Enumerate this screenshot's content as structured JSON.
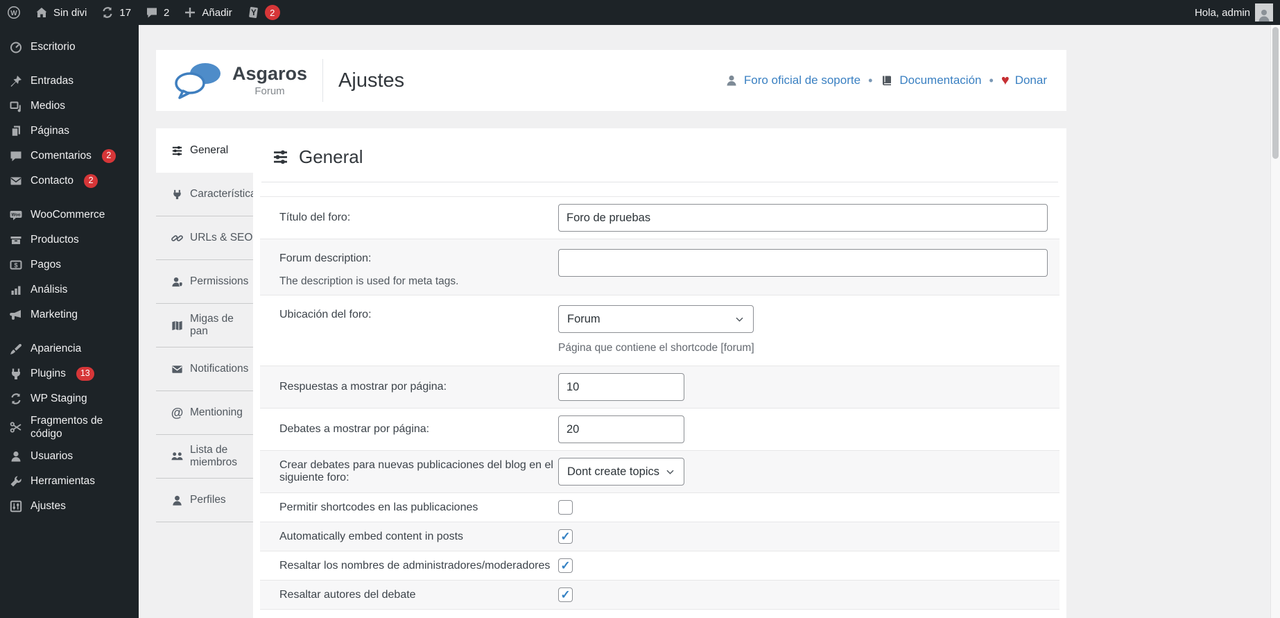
{
  "admin_bar": {
    "site_name": "Sin divi",
    "updates_count": "17",
    "comments_count": "2",
    "new_label": "Añadir",
    "yoast_count": "2",
    "greeting": "Hola, admin"
  },
  "sidebar": {
    "items": [
      {
        "label": "Escritorio"
      },
      {
        "label": "Entradas"
      },
      {
        "label": "Medios"
      },
      {
        "label": "Páginas"
      },
      {
        "label": "Comentarios",
        "badge": "2"
      },
      {
        "label": "Contacto",
        "badge": "2"
      },
      {
        "label": "WooCommerce"
      },
      {
        "label": "Productos"
      },
      {
        "label": "Pagos"
      },
      {
        "label": "Análisis"
      },
      {
        "label": "Marketing"
      },
      {
        "label": "Apariencia"
      },
      {
        "label": "Plugins",
        "badge": "13"
      },
      {
        "label": "WP Staging"
      },
      {
        "label": "Fragmentos de código"
      },
      {
        "label": "Usuarios"
      },
      {
        "label": "Herramientas"
      },
      {
        "label": "Ajustes"
      }
    ]
  },
  "header": {
    "brand_name": "Asgaros",
    "brand_sub": "Forum",
    "page_title": "Ajustes",
    "separator": "•",
    "links": {
      "support": "Foro oficial de soporte",
      "docs": "Documentación",
      "donate": "Donar"
    }
  },
  "tabs": [
    {
      "label": "General",
      "active": true
    },
    {
      "label": "Características"
    },
    {
      "label": "URLs & SEO"
    },
    {
      "label": "Permissions"
    },
    {
      "label": "Migas de pan"
    },
    {
      "label": "Notifications"
    },
    {
      "label": "Mentioning"
    },
    {
      "label": "Lista de miembros"
    },
    {
      "label": "Perfiles"
    }
  ],
  "panel": {
    "heading": "General"
  },
  "form": {
    "rows": [
      {
        "label": "Título del foro:",
        "type": "text",
        "value": "Foro de pruebas"
      },
      {
        "label": "Forum description:",
        "sublabel": "The description is used for meta tags.",
        "type": "text",
        "value": ""
      },
      {
        "label": "Ubicación del foro:",
        "type": "select",
        "value": "Forum",
        "helper": "Página que contiene el shortcode [forum]"
      },
      {
        "label": "Respuestas a mostrar por página:",
        "type": "text",
        "value": "10"
      },
      {
        "label": "Debates a mostrar por página:",
        "type": "text",
        "value": "20"
      },
      {
        "label": "Crear debates para nuevas publicaciones del blog en el siguiente foro:",
        "type": "select",
        "value": "Dont create topics"
      },
      {
        "label": "Permitir shortcodes en las publicaciones",
        "type": "checkbox",
        "checked": false
      },
      {
        "label": "Automatically embed content in posts",
        "type": "checkbox",
        "checked": true
      },
      {
        "label": "Resaltar los nombres de administradores/moderadores",
        "type": "checkbox",
        "checked": true
      },
      {
        "label": "Resaltar autores del debate",
        "type": "checkbox",
        "checked": true
      }
    ]
  },
  "icons": {
    "heart": "♥",
    "mentioning": "@",
    "checkmark": "✓"
  },
  "colors": {
    "admin_bar_bg": "#1d2327",
    "page_bg": "#f0f0f1",
    "link_blue": "#3a80c2",
    "badge_red": "#d63638",
    "logo_blue": "#4e8cc9",
    "heart_red": "#c62f33",
    "check_blue": "#3582c4"
  }
}
